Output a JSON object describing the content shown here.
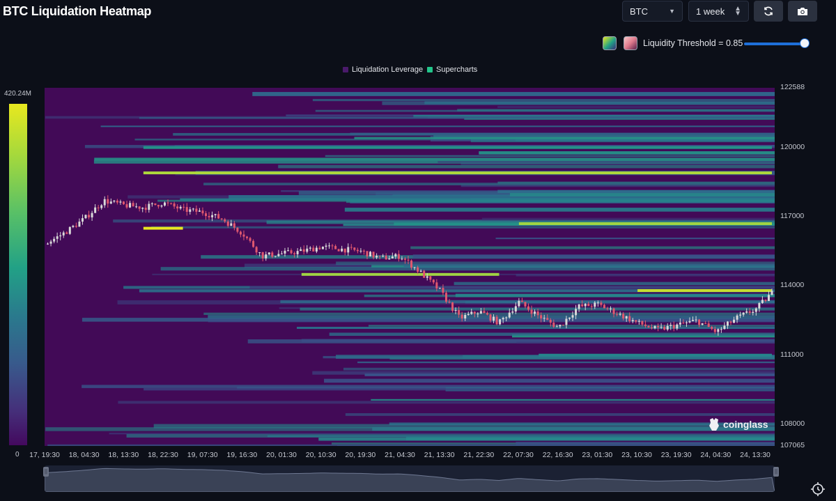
{
  "header": {
    "title": "BTC Liquidation Heatmap",
    "symbol_select": "BTC",
    "range_select": "1 week",
    "refresh_icon": "refresh-icon",
    "camera_icon": "camera-icon"
  },
  "controls": {
    "threshold_label": "Liquidity Threshold = 0.85",
    "threshold_value": 0.85,
    "palette_swatches": [
      "viridis",
      "pink"
    ]
  },
  "legend": {
    "items": [
      {
        "label": "Liquidation Leverage",
        "color": "#4a1a6b"
      },
      {
        "label": "Supercharts",
        "color": "#22c58a"
      }
    ]
  },
  "watermark": "coinglass",
  "colors": {
    "background": "#0c0f18",
    "heat_low": "#420a57",
    "heat_high": "#e8e81f",
    "candle_up": "#d9d9d9",
    "candle_down": "#e0586f"
  },
  "chart_data": {
    "type": "heatmap",
    "title": "BTC Liquidation Heatmap",
    "colorbar": {
      "max_label": "420.24M",
      "min_label": "0",
      "min": 0,
      "max": 420240000
    },
    "y_axis": {
      "min": 107065,
      "max": 122588,
      "tick_labels": [
        "122588",
        "120000",
        "117000",
        "114000",
        "111000",
        "108000",
        "107065"
      ]
    },
    "x_axis": {
      "tick_labels": [
        "17, 19:30",
        "18, 04:30",
        "18, 13:30",
        "18, 22:30",
        "19, 07:30",
        "19, 16:30",
        "20, 01:30",
        "20, 10:30",
        "20, 19:30",
        "21, 04:30",
        "21, 13:30",
        "21, 22:30",
        "22, 07:30",
        "22, 16:30",
        "23, 01:30",
        "23, 10:30",
        "23, 19:30",
        "24, 04:30",
        "24, 13:30"
      ]
    },
    "price_path": {
      "t": [
        0,
        0.5,
        1,
        1.5,
        2,
        2.5,
        3,
        3.5,
        4,
        4.5,
        5,
        5.5,
        6,
        6.5,
        7,
        7.5,
        8,
        8.5,
        9,
        9.5,
        10,
        10.5,
        11,
        11.5,
        12,
        12.5,
        13,
        13.5,
        14,
        14.5,
        15,
        15.5,
        16,
        16.5,
        17,
        17.5,
        18,
        18.4
      ],
      "price": [
        115800,
        116300,
        116900,
        117700,
        117500,
        117400,
        117600,
        117300,
        117200,
        116900,
        116300,
        115300,
        115400,
        115500,
        115700,
        115600,
        115500,
        115200,
        115300,
        114600,
        113800,
        112600,
        112900,
        112400,
        113300,
        112700,
        112200,
        113100,
        113200,
        112800,
        112400,
        112100,
        112300,
        112500,
        112000,
        112600,
        113000,
        113700
      ]
    },
    "liquidity_levels": [
      {
        "price": 118900,
        "t_start": 2.5,
        "t_end": 18.4,
        "intensity": 0.92
      },
      {
        "price": 116700,
        "t_start": 12,
        "t_end": 18.4,
        "intensity": 0.9
      },
      {
        "price": 116500,
        "t_start": 2.5,
        "t_end": 3.5,
        "intensity": 1.0
      },
      {
        "price": 114500,
        "t_start": 6.5,
        "t_end": 11.5,
        "intensity": 0.9
      },
      {
        "price": 113800,
        "t_start": 15,
        "t_end": 18.4,
        "intensity": 0.95
      },
      {
        "price": 120000,
        "t_start": 2.5,
        "t_end": 18.4,
        "intensity": 0.55
      },
      {
        "price": 111000,
        "t_start": 12.5,
        "t_end": 18.4,
        "intensity": 0.5
      }
    ]
  }
}
